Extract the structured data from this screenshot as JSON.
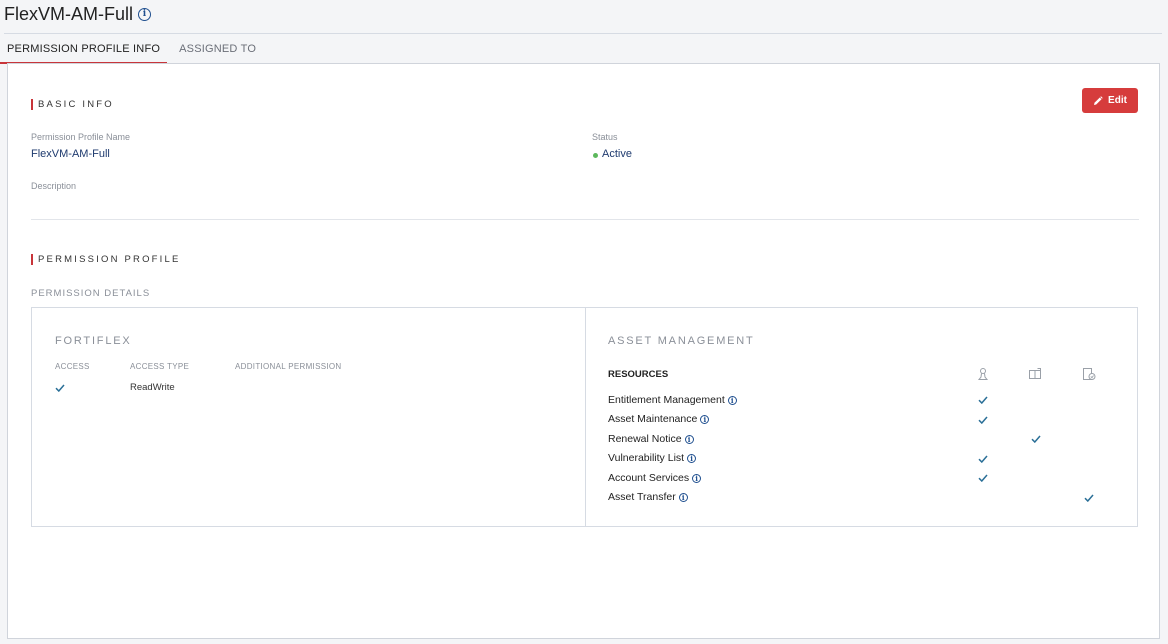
{
  "page": {
    "title": "FlexVM-AM-Full"
  },
  "tabs": [
    {
      "label": "PERMISSION PROFILE INFO",
      "active": true
    },
    {
      "label": "ASSIGNED TO",
      "active": false
    }
  ],
  "basic_info": {
    "heading": "BASIC INFO",
    "edit_label": "Edit",
    "profile_name_label": "Permission Profile Name",
    "profile_name_value": "FlexVM-AM-Full",
    "status_label": "Status",
    "status_value": "Active",
    "description_label": "Description"
  },
  "permission_profile": {
    "heading": "PERMISSION PROFILE",
    "details_label": "PERMISSION DETAILS",
    "fortiflex": {
      "title": "FORTIFLEX",
      "columns": [
        "ACCESS",
        "ACCESS TYPE",
        "ADDITIONAL PERMISSION"
      ],
      "row": {
        "access": true,
        "access_type": "ReadWrite",
        "additional_permission": ""
      }
    },
    "asset_management": {
      "title": "ASSET MANAGEMENT",
      "resources_label": "RESOURCES",
      "column_icons": [
        "user-icon",
        "read-only-icon",
        "edit-icon"
      ],
      "resources": [
        {
          "name": "Entitlement Management",
          "col": 0
        },
        {
          "name": "Asset Maintenance",
          "col": 0
        },
        {
          "name": "Renewal Notice",
          "col": 1
        },
        {
          "name": "Vulnerability List",
          "col": 0
        },
        {
          "name": "Account Services",
          "col": 0
        },
        {
          "name": "Asset Transfer",
          "col": 2
        }
      ]
    }
  },
  "colors": {
    "accent": "#c8353a",
    "edit_button": "#d63c3c",
    "link": "#1e3a6e",
    "check": "#2a6f97",
    "status_active": "#5cb85c"
  }
}
